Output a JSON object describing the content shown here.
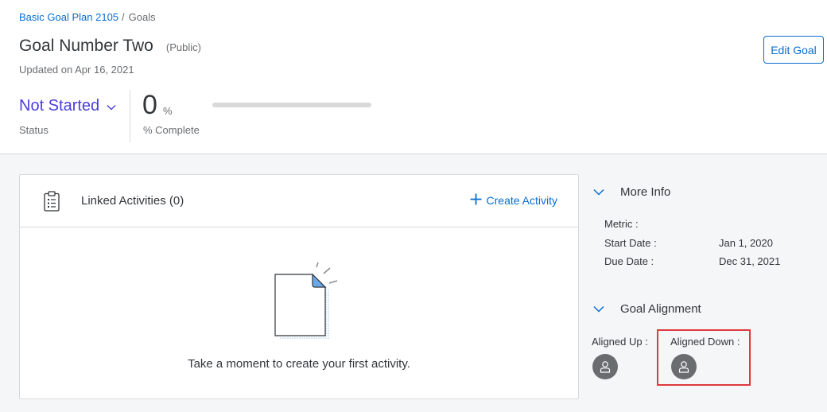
{
  "breadcrumb": {
    "parent": "Basic Goal Plan 2105",
    "separator": "/",
    "current": "Goals"
  },
  "header": {
    "title": "Goal Number Two",
    "visibility": "(Public)",
    "updated": "Updated on Apr 16, 2021",
    "edit_button": "Edit Goal"
  },
  "status": {
    "value": "Not Started",
    "label": "Status"
  },
  "progress": {
    "value": "0",
    "unit": "%",
    "label": "% Complete",
    "fraction": 0
  },
  "linked_activities": {
    "title": "Linked Activities (0)",
    "create_label": "Create Activity",
    "empty_message": "Take a moment to create your first activity."
  },
  "more_info": {
    "title": "More Info",
    "metric_label": "Metric :",
    "start_label": "Start Date :",
    "start_value": "Jan 1, 2020",
    "due_label": "Due Date :",
    "due_value": "Dec 31, 2021"
  },
  "goal_alignment": {
    "title": "Goal Alignment",
    "aligned_up_label": "Aligned Up :",
    "aligned_down_label": "Aligned Down :"
  },
  "colors": {
    "accent": "#0a6ed1",
    "status": "#4a3ddb",
    "highlight": "#e0393e",
    "avatar": "#6a6d70"
  }
}
